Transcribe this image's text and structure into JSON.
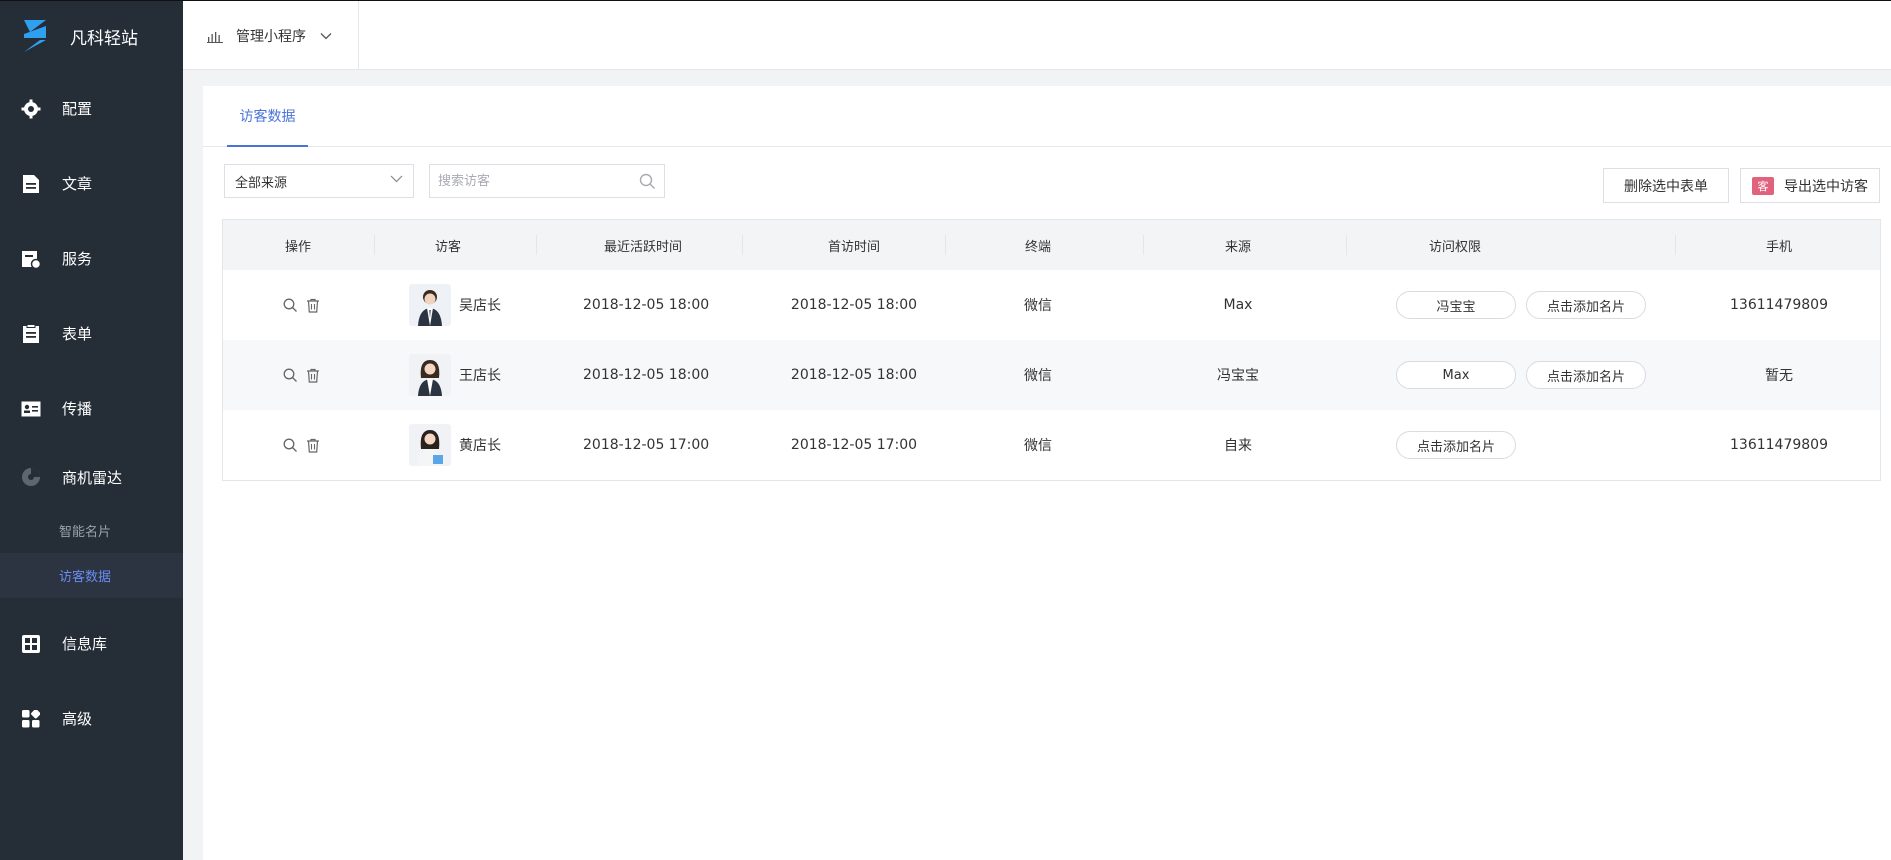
{
  "brand": {
    "name": "凡科轻站"
  },
  "sidebar": {
    "items": [
      {
        "label": "配置",
        "icon": "gear-icon"
      },
      {
        "label": "文章",
        "icon": "document-icon"
      },
      {
        "label": "服务",
        "icon": "service-icon"
      },
      {
        "label": "表单",
        "icon": "form-icon"
      },
      {
        "label": "传播",
        "icon": "card-icon"
      },
      {
        "label": "商机雷达",
        "icon": "radar-icon"
      }
    ],
    "sub_items": [
      {
        "label": "智能名片",
        "active": false
      },
      {
        "label": "访客数据",
        "active": true
      }
    ],
    "bottom_items": [
      {
        "label": "信息库",
        "icon": "grid-icon"
      },
      {
        "label": "高级",
        "icon": "apps-icon"
      }
    ]
  },
  "topbar": {
    "app_switch_label": "管理小程序"
  },
  "tabs": [
    {
      "label": "访客数据"
    }
  ],
  "filters": {
    "source_select": "全部来源",
    "search_placeholder": "搜索访客"
  },
  "actions": {
    "delete_label": "删除选中表单",
    "export_label": "导出选中访客",
    "export_badge": "客"
  },
  "table": {
    "headers": [
      "操作",
      "访客",
      "最近活跃时间",
      "首访时间",
      "终端",
      "来源",
      "访问权限",
      "手机"
    ],
    "rows": [
      {
        "visitor": "吴店长",
        "last_active": "2018-12-05 18:00",
        "first_visit": "2018-12-05 18:00",
        "terminal": "微信",
        "source": "Max",
        "permissions": [
          "冯宝宝",
          "点击添加名片"
        ],
        "phone": "13611479809"
      },
      {
        "visitor": "王店长",
        "last_active": "2018-12-05 18:00",
        "first_visit": "2018-12-05 18:00",
        "terminal": "微信",
        "source": "冯宝宝",
        "permissions": [
          "Max",
          "点击添加名片"
        ],
        "phone": "暂无"
      },
      {
        "visitor": "黄店长",
        "last_active": "2018-12-05 17:00",
        "first_visit": "2018-12-05 17:00",
        "terminal": "微信",
        "source": "自来",
        "permissions": [
          "点击添加名片"
        ],
        "phone": "13611479809"
      }
    ]
  },
  "colors": {
    "sidebar_bg": "#252d37",
    "accent": "#4a73d8",
    "logo": "#2f9ff0"
  }
}
